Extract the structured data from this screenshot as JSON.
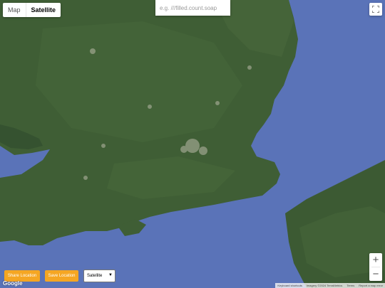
{
  "map_type_control": {
    "options": [
      "Map",
      "Satellite"
    ],
    "active": "Satellite"
  },
  "search": {
    "placeholder": "e.g. ///filled.count.soap"
  },
  "fullscreen_icon": "fullscreen-icon",
  "zoom": {
    "in_label": "+",
    "out_label": "−"
  },
  "buttons": {
    "share_location": "Share Location",
    "save_location": "Save Location"
  },
  "select": {
    "value": "Satellite"
  },
  "google_logo": "Google",
  "attribution": {
    "shortcuts": "Keyboard shortcuts",
    "imagery": "Imagery ©2024 TerraMetrics",
    "terms": "Terms",
    "report": "Report a map error"
  },
  "colors": {
    "sea": "#5a73b8",
    "land": "#3f5e35",
    "button": "#f5a623"
  }
}
